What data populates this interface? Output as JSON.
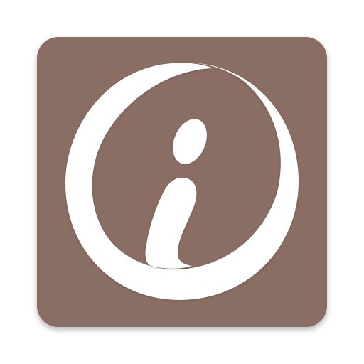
{
  "app_icon": {
    "icon_name": "info-i-icon",
    "colors": {
      "tile_background": "#8a6d63",
      "symbol": "#ffffff",
      "page_background": "#ffffff"
    }
  }
}
